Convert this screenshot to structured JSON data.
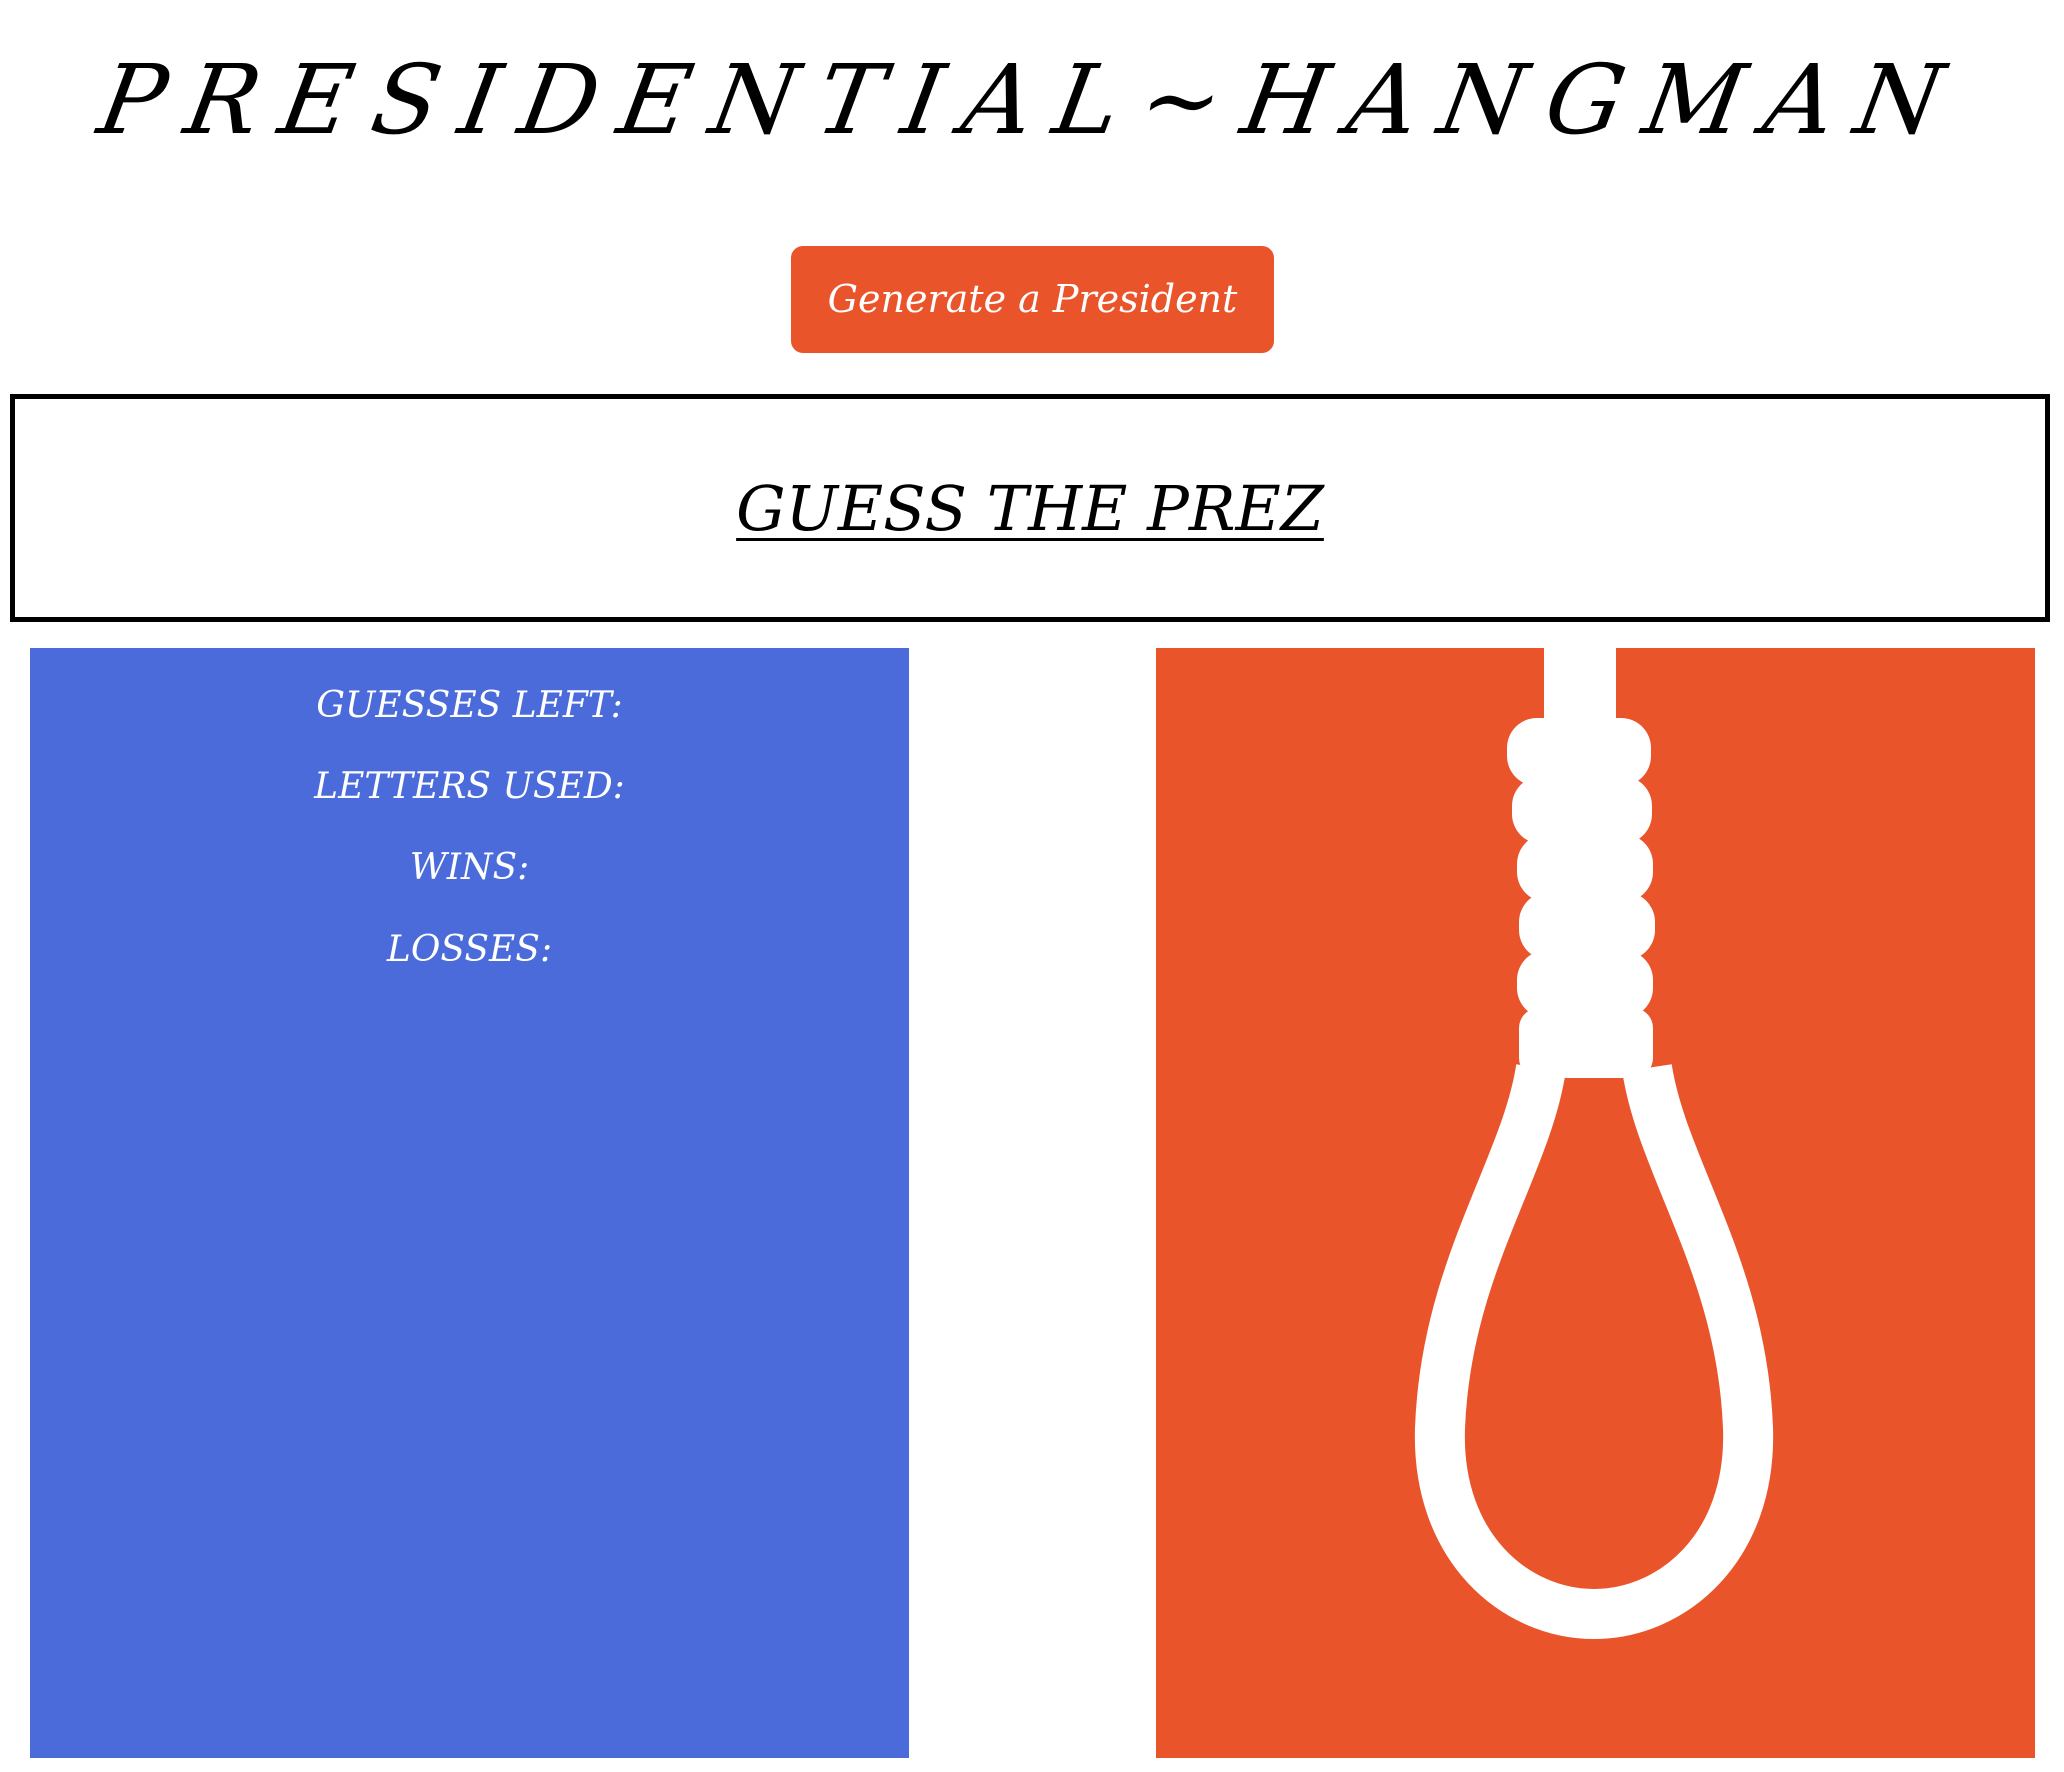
{
  "header": {
    "title": "PRESIDENTIAL~HANGMAN"
  },
  "controls": {
    "generate_label": "Generate a President"
  },
  "game": {
    "heading": "GUESS THE PREZ"
  },
  "stats": {
    "guesses_left_label": "GUESSES LEFT:",
    "letters_used_label": "LETTERS USED:",
    "wins_label": "WINS:",
    "losses_label": "LOSSES:"
  },
  "illustration": {
    "icon": "noose-icon"
  },
  "colors": {
    "accent": "#e9542b",
    "panel_blue": "#4a6bd9",
    "text_light": "#ffffff",
    "text_dark": "#000000"
  }
}
